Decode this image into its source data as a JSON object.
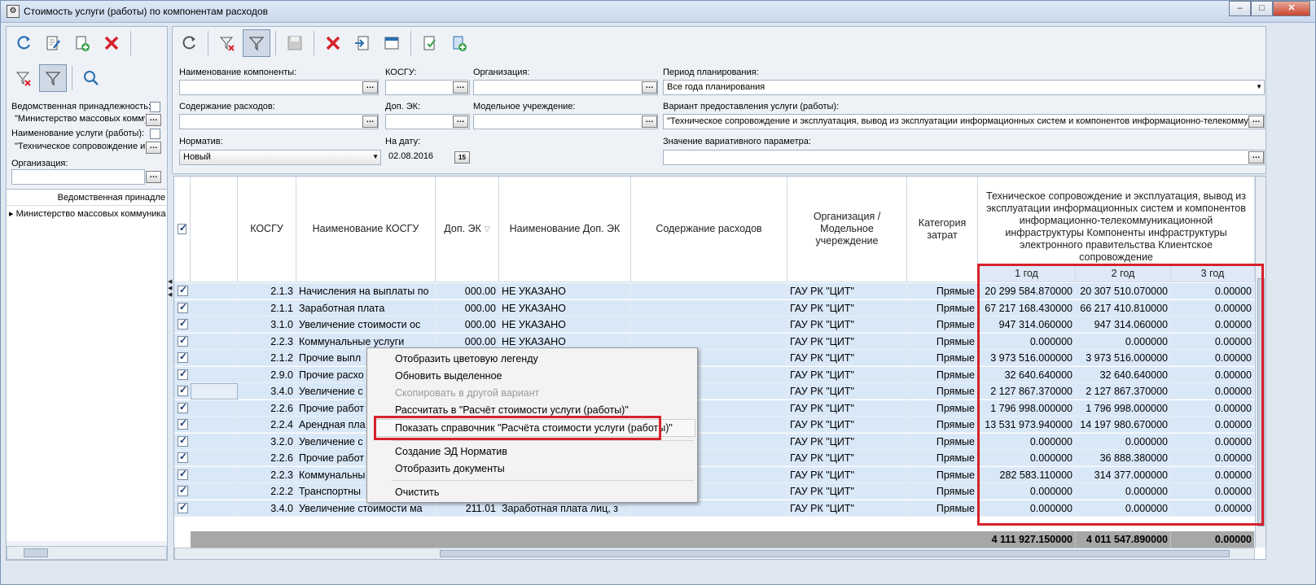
{
  "window": {
    "title": "Стоимость услуги (работы) по компонентам расходов",
    "min": "–",
    "max": "□",
    "close": "✕"
  },
  "left_filters": {
    "vedomstv_label": "Ведомственная принадлежность:",
    "vedomstv_value": "\"Министерство массовых комму",
    "usluga_label": "Наименование услуги (работы):",
    "usluga_value": "\"Техническое сопровождение и",
    "org_label": "Организация:",
    "org_value": "",
    "dots": "…"
  },
  "left_tree": {
    "header": "Ведомственная принадле",
    "item": "Министерство массовых коммуника"
  },
  "filters": {
    "komp_label": "Наименование компоненты:",
    "kosgu_label": "КОСГУ:",
    "org_label": "Организация:",
    "period_label": "Период планирования:",
    "period_value": "Все года планирования",
    "soderzh_label": "Содержание расходов:",
    "dopek_label": "Доп. ЭК:",
    "model_label": "Модельное учреждение:",
    "variant_label": "Вариант предоставления услуги (работы):",
    "variant_value": "\"Техническое сопровождение и эксплуатация, вывод из эксплуатации информационных систем и компонентов информационно-телекоммуник",
    "normativ_label": "Норматив:",
    "normativ_value": "Новый",
    "date_label": "На дату:",
    "date_value": "02.08.2016",
    "cal": "15",
    "znach_label": "Значение вариативного параметра:",
    "dots": "…"
  },
  "grid": {
    "headers": {
      "kosgu": "КОСГУ",
      "kosgu_name": "Наименование КОСГУ",
      "dopek": "Доп. ЭК",
      "dopek_name": "Наименование Доп. ЭК",
      "soderzh": "Содержание расходов",
      "org": "Организация / Модельное учереждение",
      "kat": "Категория затрат",
      "group": "Техническое сопровождение и эксплуатация, вывод из эксплуатации информационных систем и компонентов информационно-телекоммуникационной инфраструктуры Компоненты инфраструктуры электронного правительства Клиентское сопровождение",
      "y1": "1 год",
      "y2": "2 год",
      "y3": "3 год"
    },
    "rows": [
      {
        "kosgu": "2.1.3",
        "name": "Начисления на выплаты по",
        "dopek": "000.00",
        "dopname": "НЕ УКАЗАНО",
        "org": "ГАУ РК \"ЦИТ\"",
        "kat": "Прямые",
        "y1": "20 299 584.870000",
        "y2": "20 307 510.070000",
        "y3": "0.00000"
      },
      {
        "kosgu": "2.1.1",
        "name": "Заработная плата",
        "dopek": "000.00",
        "dopname": "НЕ УКАЗАНО",
        "org": "ГАУ РК \"ЦИТ\"",
        "kat": "Прямые",
        "y1": "67 217 168.430000",
        "y2": "66 217 410.810000",
        "y3": "0.00000"
      },
      {
        "kosgu": "3.1.0",
        "name": "Увеличение стоимости ос",
        "dopek": "000.00",
        "dopname": "НЕ УКАЗАНО",
        "org": "ГАУ РК \"ЦИТ\"",
        "kat": "Прямые",
        "y1": "947 314.060000",
        "y2": "947 314.060000",
        "y3": "0.00000"
      },
      {
        "kosgu": "2.2.3",
        "name": "Коммунальные услуги",
        "dopek": "000.00",
        "dopname": "НЕ УКАЗАНО",
        "org": "ГАУ РК \"ЦИТ\"",
        "kat": "Прямые",
        "y1": "0.000000",
        "y2": "0.000000",
        "y3": "0.00000"
      },
      {
        "kosgu": "2.1.2",
        "name": "Прочие выпл",
        "dopek": "",
        "dopname": "",
        "org": "ГАУ РК \"ЦИТ\"",
        "kat": "Прямые",
        "y1": "3 973 516.000000",
        "y2": "3 973 516.000000",
        "y3": "0.00000"
      },
      {
        "kosgu": "2.9.0",
        "name": "Прочие расхо",
        "dopek": "",
        "dopname": "",
        "org": "ГАУ РК \"ЦИТ\"",
        "kat": "Прямые",
        "y1": "32 640.640000",
        "y2": "32 640.640000",
        "y3": "0.00000"
      },
      {
        "kosgu": "3.4.0",
        "name": "Увеличение с",
        "dopek": "",
        "dopname": "",
        "org": "ГАУ РК \"ЦИТ\"",
        "kat": "Прямые",
        "y1": "2 127 867.370000",
        "y2": "2 127 867.370000",
        "y3": "0.00000"
      },
      {
        "kosgu": "2.2.6",
        "name": "Прочие работ",
        "dopek": "",
        "dopname": "",
        "org": "ГАУ РК \"ЦИТ\"",
        "kat": "Прямые",
        "y1": "1 796 998.000000",
        "y2": "1 796 998.000000",
        "y3": "0.00000"
      },
      {
        "kosgu": "2.2.4",
        "name": "Арендная пла",
        "dopek": "",
        "dopname": "",
        "org": "ГАУ РК \"ЦИТ\"",
        "kat": "Прямые",
        "y1": "13 531 973.940000",
        "y2": "14 197 980.670000",
        "y3": "0.00000"
      },
      {
        "kosgu": "3.2.0",
        "name": "Увеличение с",
        "dopek": "",
        "dopname": "",
        "org": "ГАУ РК \"ЦИТ\"",
        "kat": "Прямые",
        "y1": "0.000000",
        "y2": "0.000000",
        "y3": "0.00000"
      },
      {
        "kosgu": "2.2.6",
        "name": "Прочие работ",
        "dopek": "",
        "dopname": "",
        "org": "ГАУ РК \"ЦИТ\"",
        "kat": "Прямые",
        "y1": "0.000000",
        "y2": "36 888.380000",
        "y3": "0.00000"
      },
      {
        "kosgu": "2.2.3",
        "name": "Коммунальны",
        "dopek": "",
        "dopname": "",
        "org": "ГАУ РК \"ЦИТ\"",
        "kat": "Прямые",
        "y1": "282 583.110000",
        "y2": "314 377.000000",
        "y3": "0.00000"
      },
      {
        "kosgu": "2.2.2",
        "name": "Транспортны",
        "dopek": "",
        "dopname": "",
        "org": "ГАУ РК \"ЦИТ\"",
        "kat": "Прямые",
        "y1": "0.000000",
        "y2": "0.000000",
        "y3": "0.00000"
      },
      {
        "kosgu": "3.4.0",
        "name": "Увеличение стоимости ма",
        "dopek": "211.01",
        "dopname": "Заработная плата лиц, з",
        "org": "ГАУ РК \"ЦИТ\"",
        "kat": "Прямые",
        "y1": "0.000000",
        "y2": "0.000000",
        "y3": "0.00000"
      }
    ],
    "totals": {
      "y1": "4 111 927.150000",
      "y2": "4 011 547.890000",
      "y3": "0.00000"
    }
  },
  "context_menu": {
    "items": [
      {
        "label": "Отобразить цветовую легенду",
        "disabled": false
      },
      {
        "label": "Обновить выделенное",
        "disabled": false
      },
      {
        "label": "Скопировать в другой вариант",
        "disabled": true
      },
      {
        "label": "Рассчитать в \"Расчёт стоимости услуги (работы)\"",
        "disabled": false
      },
      {
        "label": "Показать справочник \"Расчёта стоимости услуги (работы)\"",
        "disabled": false
      },
      {
        "label": "Создание ЭД Норматив",
        "disabled": false
      },
      {
        "label": "Отобразить документы",
        "disabled": false
      },
      {
        "label": "Очистить",
        "disabled": false
      }
    ]
  },
  "colors": {
    "highlight": "#d7222b",
    "row_bg": "#d9e8f7"
  }
}
